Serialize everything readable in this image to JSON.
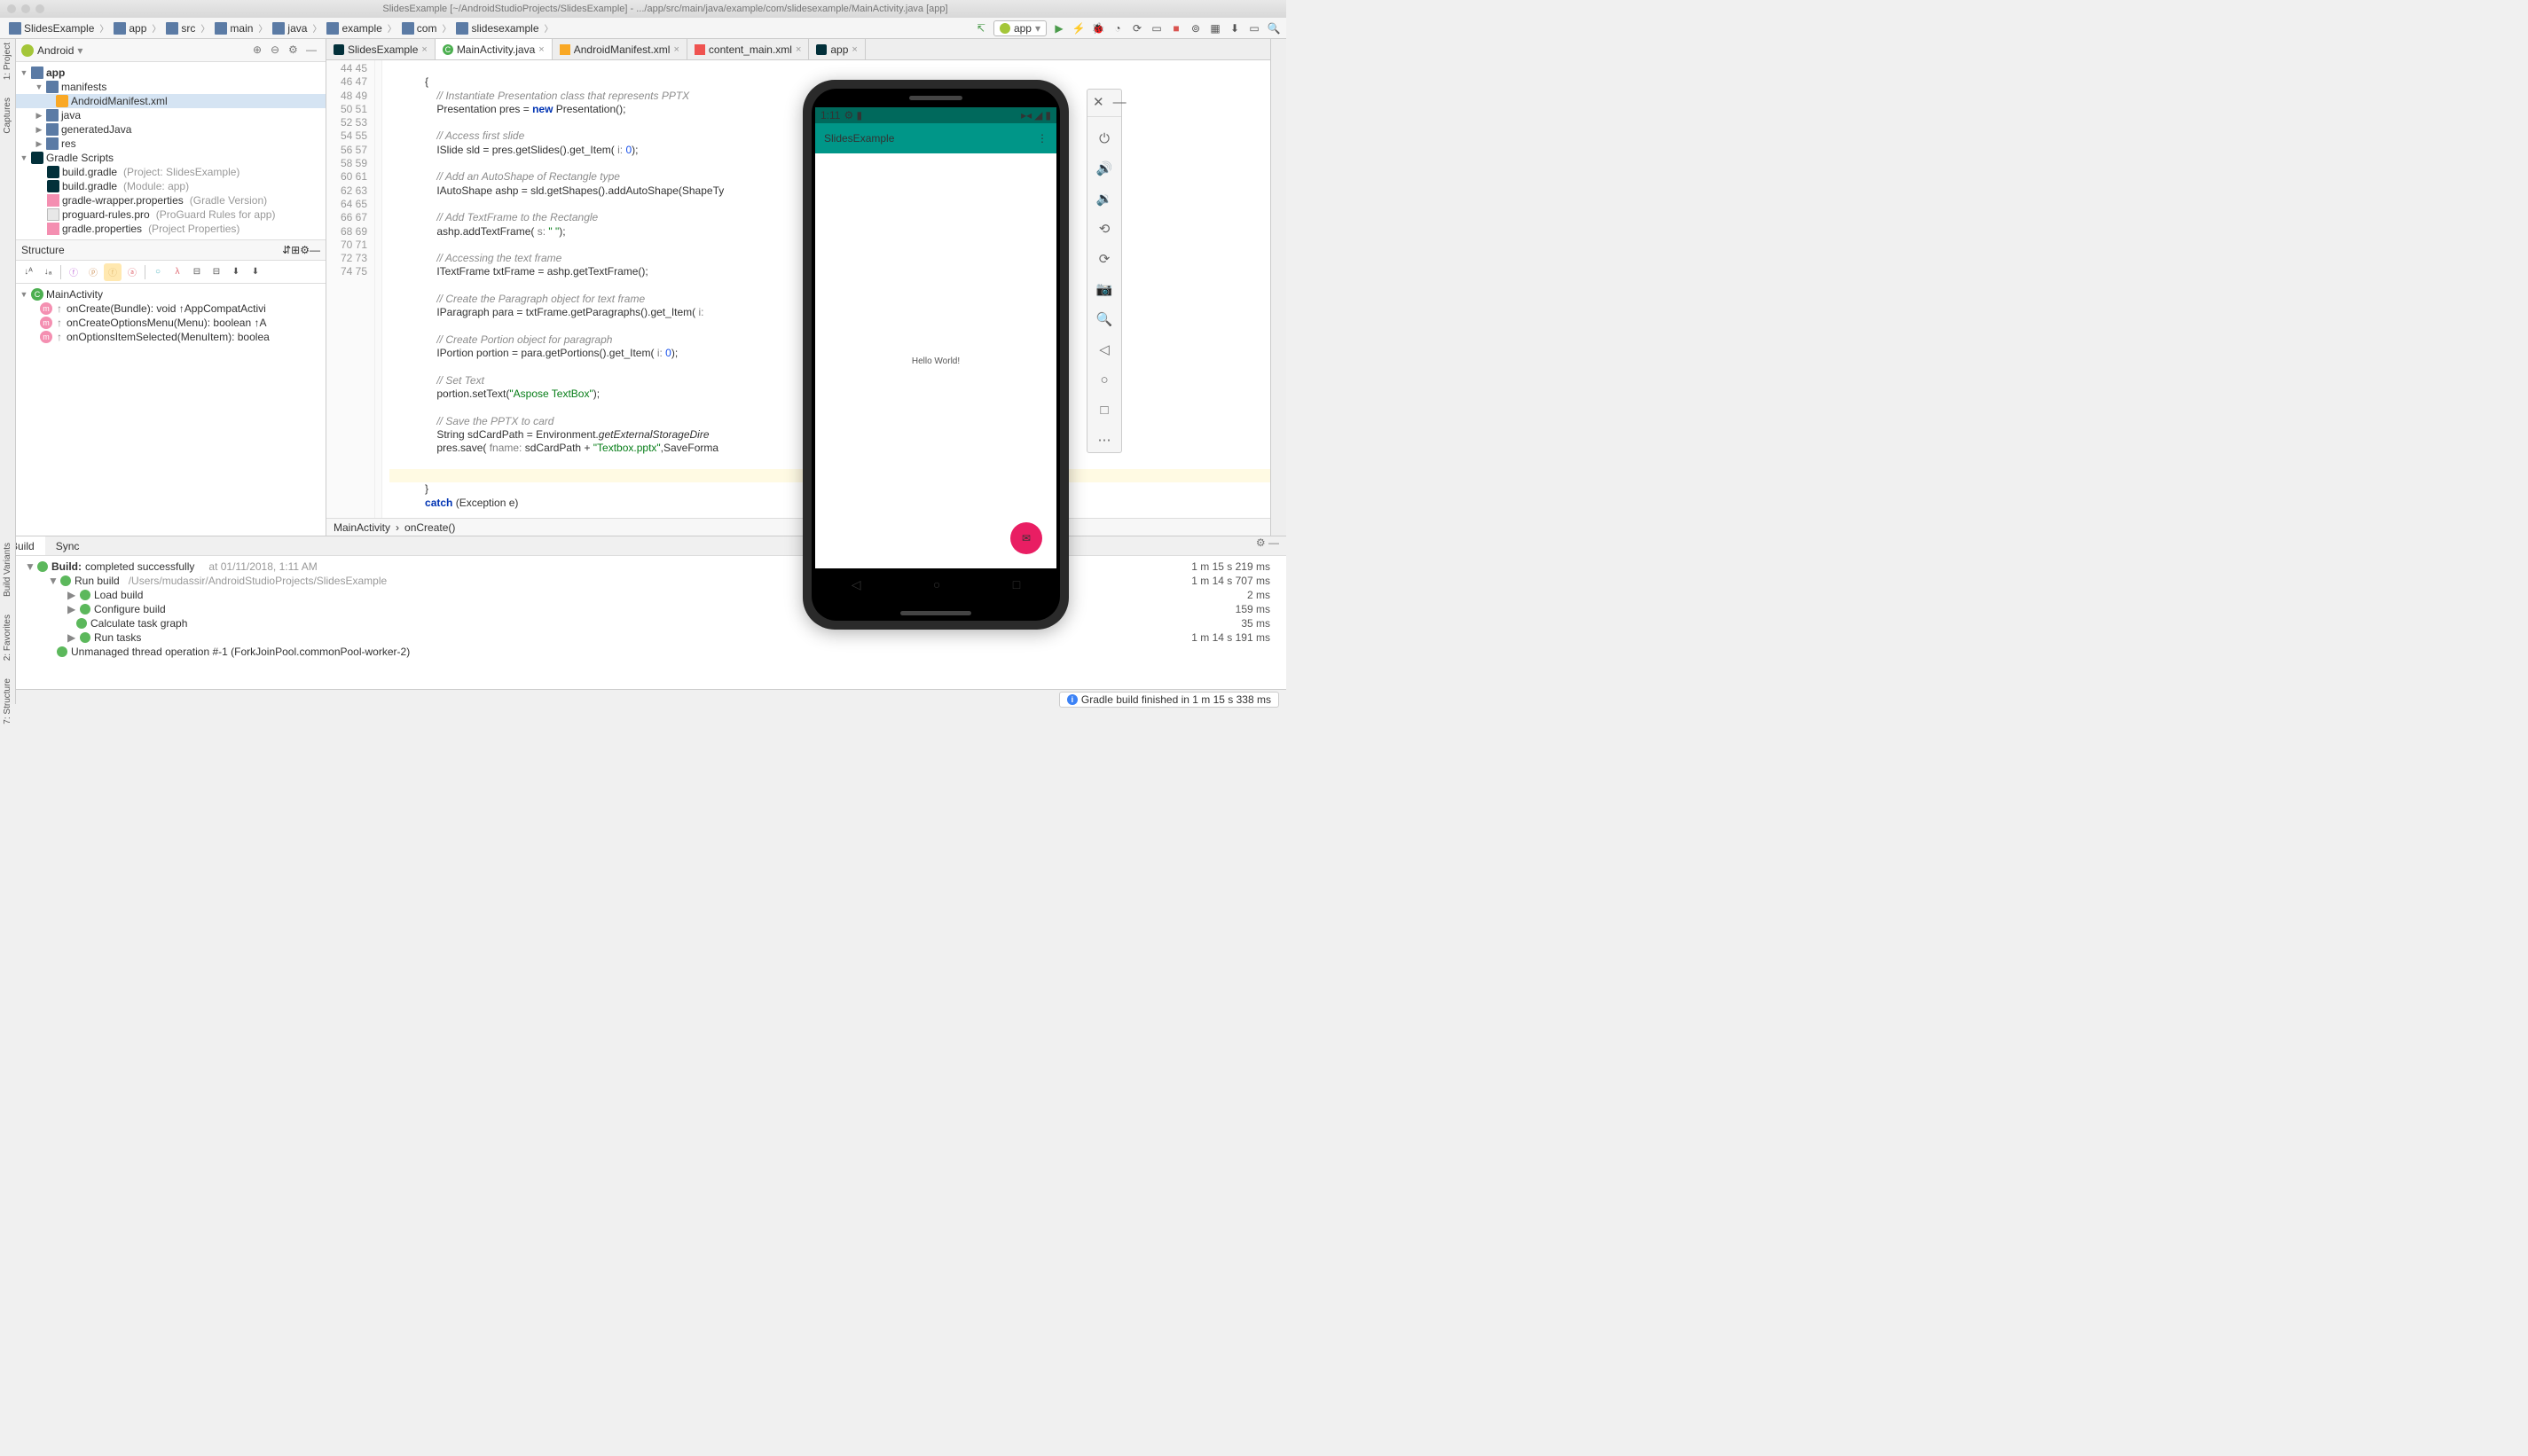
{
  "title": "SlidesExample [~/AndroidStudioProjects/SlidesExample] - .../app/src/main/java/example/com/slidesexample/MainActivity.java [app]",
  "breadcrumbs": [
    "SlidesExample",
    "app",
    "src",
    "main",
    "java",
    "example",
    "com",
    "slidesexample"
  ],
  "run_config": "app",
  "left_rail": {
    "project": "1: Project",
    "captures": "Captures",
    "variants": "Build Variants",
    "favorites": "2: Favorites",
    "structure": "7: Structure"
  },
  "project_panel": {
    "header": "Android",
    "tree": {
      "app": "app",
      "manifests": "manifests",
      "manifest_file": "AndroidManifest.xml",
      "java": "java",
      "gen_java": "generatedJava",
      "res": "res",
      "gradle_scripts": "Gradle Scripts",
      "bg1": "build.gradle",
      "bg1_hint": "(Project: SlidesExample)",
      "bg2": "build.gradle",
      "bg2_hint": "(Module: app)",
      "gwp": "gradle-wrapper.properties",
      "gwp_hint": "(Gradle Version)",
      "pgr": "proguard-rules.pro",
      "pgr_hint": "(ProGuard Rules for app)",
      "gp": "gradle.properties",
      "gp_hint": "(Project Properties)"
    }
  },
  "structure": {
    "header": "Structure",
    "main_activity": "MainActivity",
    "m1": "onCreate(Bundle): void ↑AppCompatActivi",
    "m2": "onCreateOptionsMenu(Menu): boolean ↑A",
    "m3": "onOptionsItemSelected(MenuItem): boolea"
  },
  "tabs": {
    "t1": "SlidesExample",
    "t2": "MainActivity.java",
    "t3": "AndroidManifest.xml",
    "t4": "content_main.xml",
    "t5": "app"
  },
  "gutter_start": 44,
  "gutter_end": 75,
  "code": {
    "l44": "            {",
    "l45a": "                ",
    "l45c": "// Instantiate Presentation class that represents PPTX",
    "l46a": "                Presentation pres = ",
    "l46k": "new",
    "l46b": " Presentation();",
    "l48": "                ",
    "l48c": "// Access first slide",
    "l49a": "                ISlide sld = pres.getSlides().get_Item( ",
    "l49p": "i: ",
    "l49n": "0",
    "l49b": ");",
    "l51": "                ",
    "l51c": "// Add an AutoShape of Rectangle type",
    "l52": "                IAutoShape ashp = sld.getShapes().addAutoShape(ShapeTy",
    "l54": "                ",
    "l54c": "// Add TextFrame to the Rectangle",
    "l55a": "                ashp.addTextFrame( ",
    "l55p": "s: ",
    "l55s": "\" \"",
    "l55b": ");",
    "l57": "                ",
    "l57c": "// Accessing the text frame",
    "l58": "                ITextFrame txtFrame = ashp.getTextFrame();",
    "l60": "                ",
    "l60c": "// Create the Paragraph object for text frame",
    "l61a": "                IParagraph para = txtFrame.getParagraphs().get_Item( ",
    "l61p": "i:",
    "l63": "                ",
    "l63c": "// Create Portion object for paragraph",
    "l64a": "                IPortion portion = para.getPortions().get_Item( ",
    "l64p": "i: ",
    "l64n": "0",
    "l64b": ");",
    "l66": "                ",
    "l66c": "// Set Text",
    "l67a": "                portion.setText(",
    "l67s": "\"Aspose TextBox\"",
    "l67b": ");",
    "l69": "                ",
    "l69c": "// Save the PPTX to card",
    "l70a": "                String sdCardPath = Environment.",
    "l70i": "getExternalStorageDire",
    "l71a": "                pres.save( ",
    "l71p": "fname: ",
    "l71b": "sdCardPath + ",
    "l71s": "\"Textbox.pptx\"",
    "l71c": ",SaveForma",
    "l74": "            }",
    "l75a": "            ",
    "l75k": "catch",
    "l75b": " (Exception e)"
  },
  "editor_crumb": {
    "c1": "MainActivity",
    "c2": "onCreate()"
  },
  "bottom_tabs": {
    "build": "Build",
    "sync": "Sync"
  },
  "build": {
    "r1a": "Build:",
    "r1b": " completed successfully",
    "r1t": "at 01/11/2018, 1:11 AM",
    "r1d": "1 m 15 s 219 ms",
    "r2": "Run build",
    "r2h": "/Users/mudassir/AndroidStudioProjects/SlidesExample",
    "r2d": "1 m 14 s 707 ms",
    "r3": "Load build",
    "r3d": "2 ms",
    "r4": "Configure build",
    "r4d": "159 ms",
    "r5": "Calculate task graph",
    "r5d": "35 ms",
    "r6": "Run tasks",
    "r6d": "1 m 14 s 191 ms",
    "r7": "Unmanaged thread operation #-1 (ForkJoinPool.commonPool-worker-2)"
  },
  "status": "Gradle build finished in 1 m 15 s 338 ms",
  "emulator": {
    "time": "1:11",
    "app_title": "SlidesExample",
    "hello": "Hello World!"
  }
}
